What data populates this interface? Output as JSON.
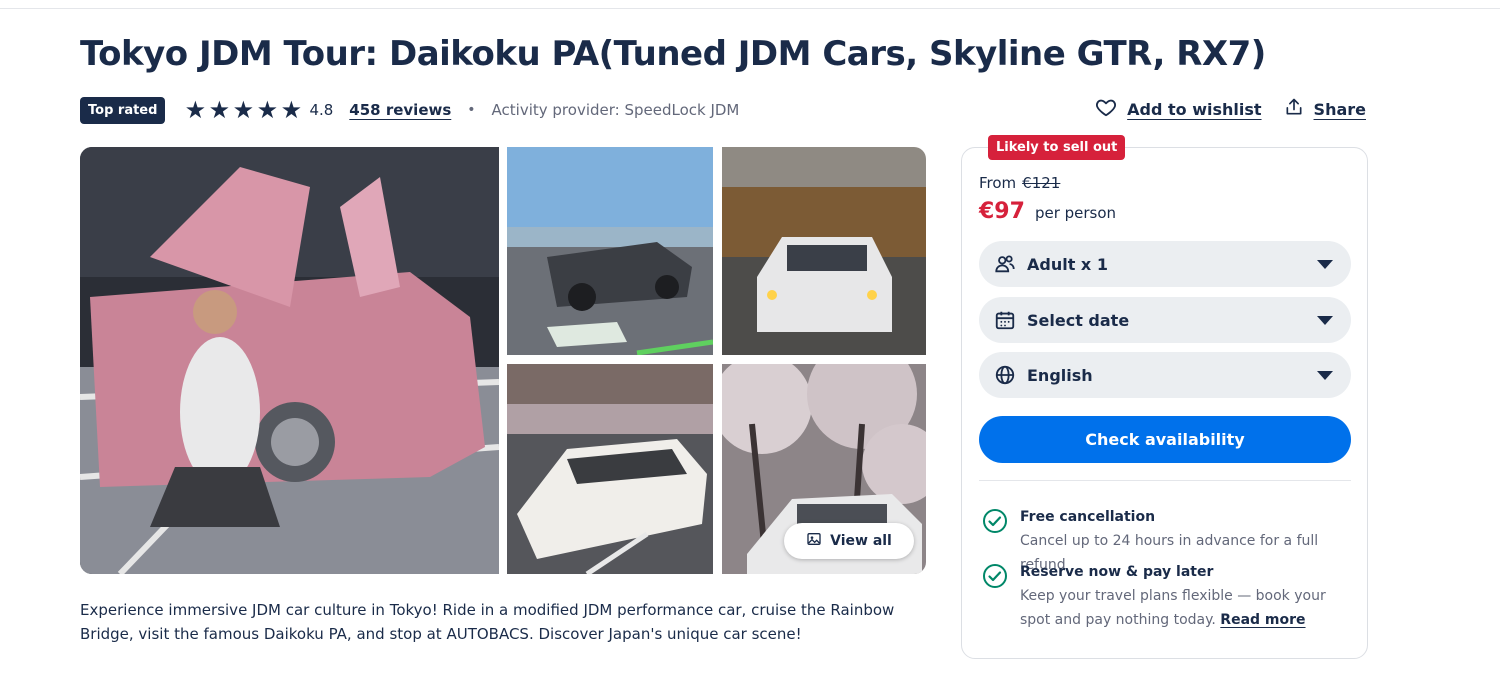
{
  "title": "Tokyo JDM Tour: Daikoku PA(Tuned JDM Cars, Skyline GTR, RX7)",
  "meta": {
    "badge": "Top rated",
    "stars": 5,
    "rating": "4.8",
    "reviews": "458 reviews",
    "separator": "•",
    "provider": "Activity provider: SpeedLock JDM"
  },
  "actions": {
    "wishlist": "Add to wishlist",
    "share": "Share"
  },
  "gallery": {
    "view_all": "View all"
  },
  "description": "Experience immersive JDM car culture in Tokyo! Ride in a modified JDM performance car, cruise the Rainbow Bridge, visit the famous Daikoku PA, and stop at AUTOBACS. Discover Japan's unique car scene!",
  "booking": {
    "badge": "Likely to sell out",
    "from_label": "From",
    "old_price": "€121",
    "price": "€97",
    "per_person": "per person",
    "participants": "Adult x 1",
    "date": "Select date",
    "language": "English",
    "cta": "Check availability",
    "features": [
      {
        "title": "Free cancellation",
        "desc": "Cancel up to 24 hours in advance for a full refund"
      },
      {
        "title": "Reserve now & pay later",
        "desc": "Keep your travel plans flexible — book your spot and pay nothing today.",
        "link": "Read more"
      }
    ]
  },
  "colors": {
    "navy": "#1a2b49",
    "accent_blue": "#0071eb",
    "alert_red": "#d6213b",
    "success_green": "#008768"
  },
  "icons": [
    "star-icon",
    "heart-icon",
    "share-icon",
    "image-icon",
    "people-icon",
    "calendar-icon",
    "globe-icon",
    "chevron-down-icon",
    "check-circle-icon"
  ]
}
